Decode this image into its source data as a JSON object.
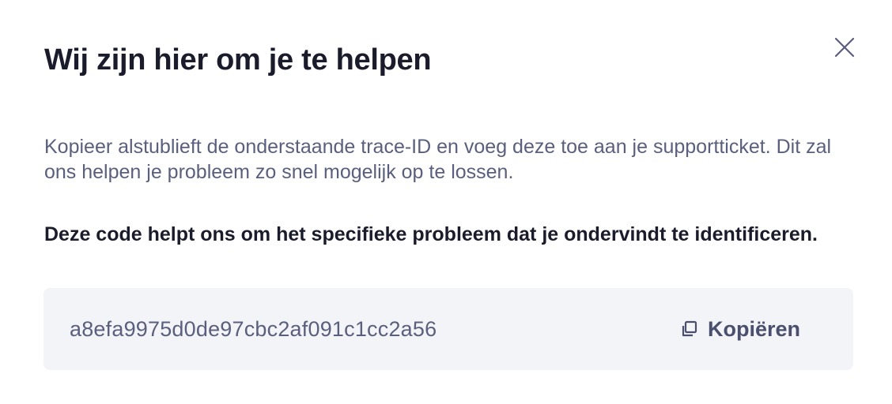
{
  "dialog": {
    "title": "Wij zijn hier om je te helpen",
    "description": "Kopieer alstublieft de onderstaande trace-ID en voeg deze toe aan je supportticket. Dit zal ons helpen je probleem zo snel mogelijk op te lossen.",
    "code_heading": "Deze code helpt ons om het specifieke probleem dat je ondervindt te identificeren.",
    "trace_id": "a8efa9975d0de97cbc2af091c1cc2a56",
    "copy_label": "Kopiëren",
    "close_icon": "close-icon",
    "copy_icon": "copy-icon"
  },
  "colors": {
    "title": "#1b1c2b",
    "body_text": "#5a5f7d",
    "trace_box_bg": "#f3f4f8",
    "icon": "#5a5f7d"
  }
}
